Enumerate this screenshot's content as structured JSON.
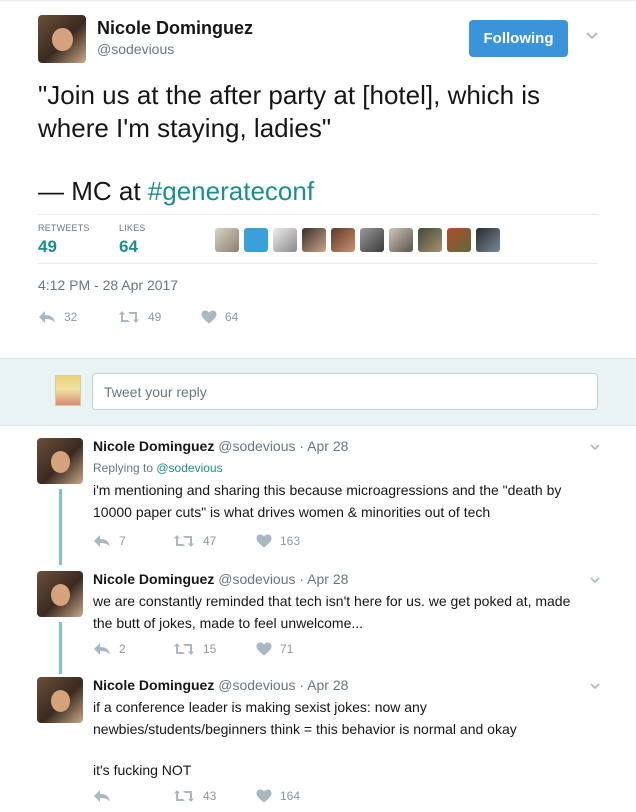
{
  "main": {
    "user_name": "Nicole Dominguez",
    "user_handle": "@sodevious",
    "follow_label": "Following",
    "text_line1": "\"Join us at the after party at [hotel], which is",
    "text_line2": "where I'm staying, ladies\"",
    "text_line3_prefix": "— MC at ",
    "hashtag": "#generateconf",
    "retweets_label": "RETWEETS",
    "retweets_value": "49",
    "likes_label": "LIKES",
    "likes_value": "64",
    "timestamp": "4:12 PM - 28 Apr 2017",
    "actions": {
      "replies": "32",
      "retweets": "49",
      "likes": "64"
    }
  },
  "reply_box": {
    "placeholder": "Tweet your reply"
  },
  "replies": [
    {
      "name": "Nicole Dominguez",
      "meta": "@sodevious · Apr 28",
      "replying_prefix": "Replying to ",
      "replying_handle": "@sodevious",
      "text_line1": "i'm mentioning and sharing this because microagressions and the \"death by",
      "text_line2": "10000 paper cuts\" is what drives women & minorities out of tech",
      "replies": "7",
      "retweets": "47",
      "likes": "163"
    },
    {
      "name": "Nicole Dominguez",
      "meta": "@sodevious · Apr 28",
      "text_line1": "we are constantly reminded that tech isn't here for us. we get poked at, made",
      "text_line2": "the butt of jokes, made to feel unwelcome...",
      "replies": "2",
      "retweets": "15",
      "likes": "71"
    },
    {
      "name": "Nicole Dominguez",
      "meta": "@sodevious · Apr 28",
      "text_line1": "if a conference leader is making sexist jokes: now any",
      "text_line2": "newbies/students/beginners think = this behavior is normal and okay",
      "text_line3": "it's fucking NOT",
      "replies": "",
      "retweets": "43",
      "likes": "164"
    }
  ],
  "colors": {
    "accent": "#1b8f8a",
    "follow_button": "#3b94d9",
    "thread_line": "#7cc5c1",
    "reply_box_bg": "#eaf3f3"
  },
  "icons": [
    "caret-down-icon",
    "reply-icon",
    "retweet-icon",
    "heart-icon"
  ],
  "likers": [
    "liker-1",
    "liker-2",
    "liker-3",
    "liker-4",
    "liker-5",
    "liker-6",
    "liker-7",
    "liker-8",
    "liker-9",
    "liker-10"
  ]
}
